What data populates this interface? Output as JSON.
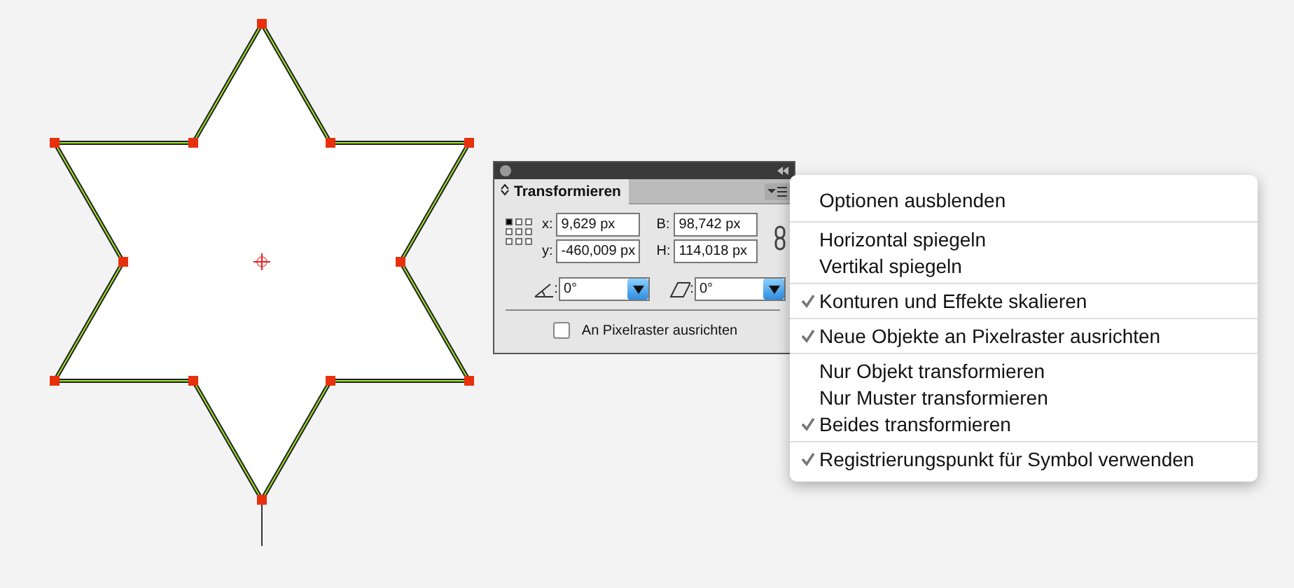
{
  "panel": {
    "tab": "Transformieren",
    "fields": [
      {
        "label": "x:",
        "value": "9,629 px"
      },
      {
        "label": "B:",
        "value": "98,742 px"
      },
      {
        "label": "y:",
        "value": "-460,009 px"
      },
      {
        "label": "H:",
        "value": "114,018 px"
      }
    ],
    "angle": {
      "label": ":",
      "value": "0°"
    },
    "shear": {
      "label": ":",
      "value": "0°"
    },
    "checkbox": {
      "label": "An Pixelraster ausrichten",
      "checked": false
    }
  },
  "menu": {
    "sections": [
      {
        "items": [
          {
            "label": "Optionen ausblenden",
            "checked": false
          }
        ]
      },
      {
        "items": [
          {
            "label": "Horizontal spiegeln",
            "checked": false
          },
          {
            "label": "Vertikal spiegeln",
            "checked": false
          }
        ]
      },
      {
        "items": [
          {
            "label": "Konturen und Effekte skalieren",
            "checked": true
          }
        ]
      },
      {
        "items": [
          {
            "label": "Neue Objekte an Pixelraster ausrichten",
            "checked": true
          }
        ]
      },
      {
        "items": [
          {
            "label": "Nur Objekt transformieren",
            "checked": false
          },
          {
            "label": "Nur Muster transformieren",
            "checked": false
          },
          {
            "label": "Beides transformieren",
            "checked": true
          }
        ]
      },
      {
        "items": [
          {
            "label": "Registrierungspunkt für Symbol verwenden",
            "checked": true
          }
        ]
      }
    ]
  }
}
